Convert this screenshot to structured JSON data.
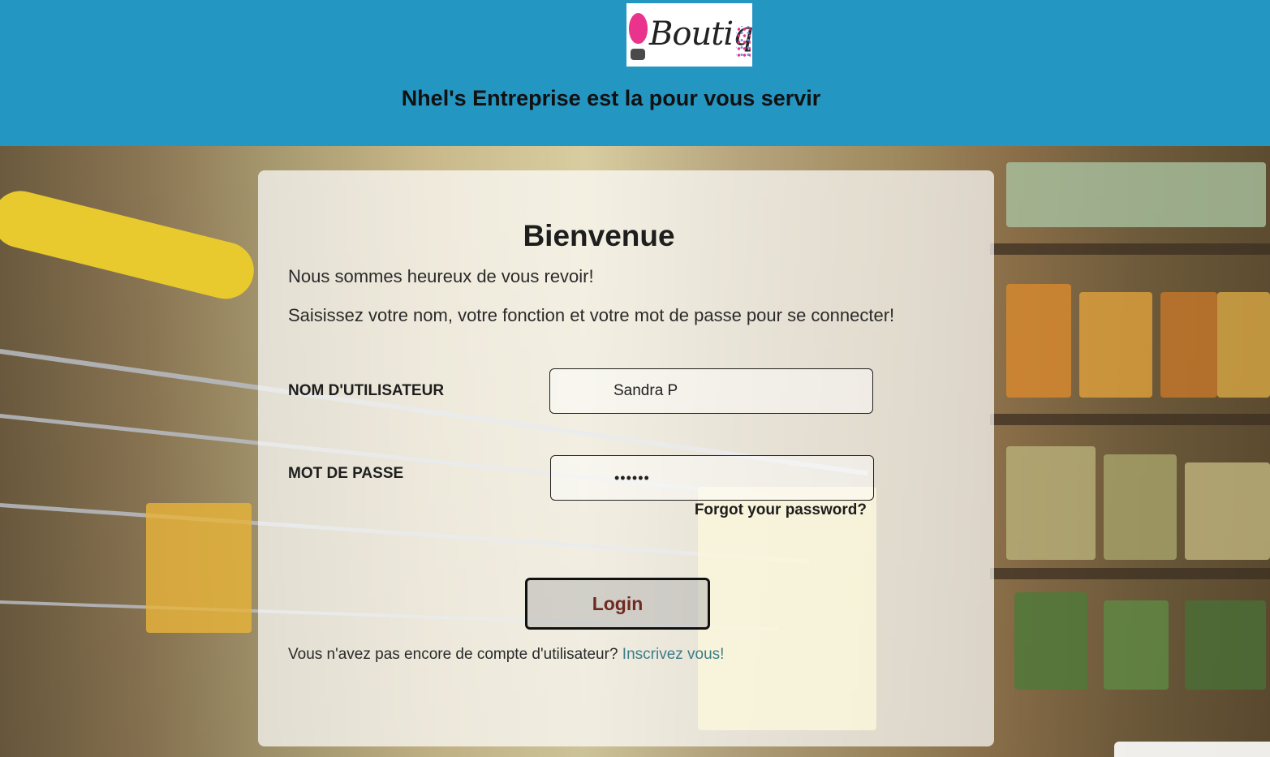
{
  "header": {
    "logo_text": "Boutique",
    "tagline": "Nhel's Entreprise est la pour vous servir"
  },
  "card": {
    "title": "Bienvenue",
    "intro": "Nous sommes heureux de vous revoir!",
    "instructions": "Saisissez votre nom, votre fonction et votre mot de passe pour se connecter!",
    "username_label": "NOM D'UTILISATEUR",
    "username_value": "Sandra P",
    "password_label": "MOT DE PASSE",
    "password_value": "••••••",
    "forgot_label": "Forgot your password?",
    "login_label": "Login",
    "signup_prompt": "Vous n'avez pas encore de compte d'utilisateur?",
    "signup_link": "Inscrivez vous!"
  },
  "colors": {
    "header_bg": "#2496c2",
    "signup_link": "#3c7d87",
    "login_text": "#6e2a20"
  }
}
